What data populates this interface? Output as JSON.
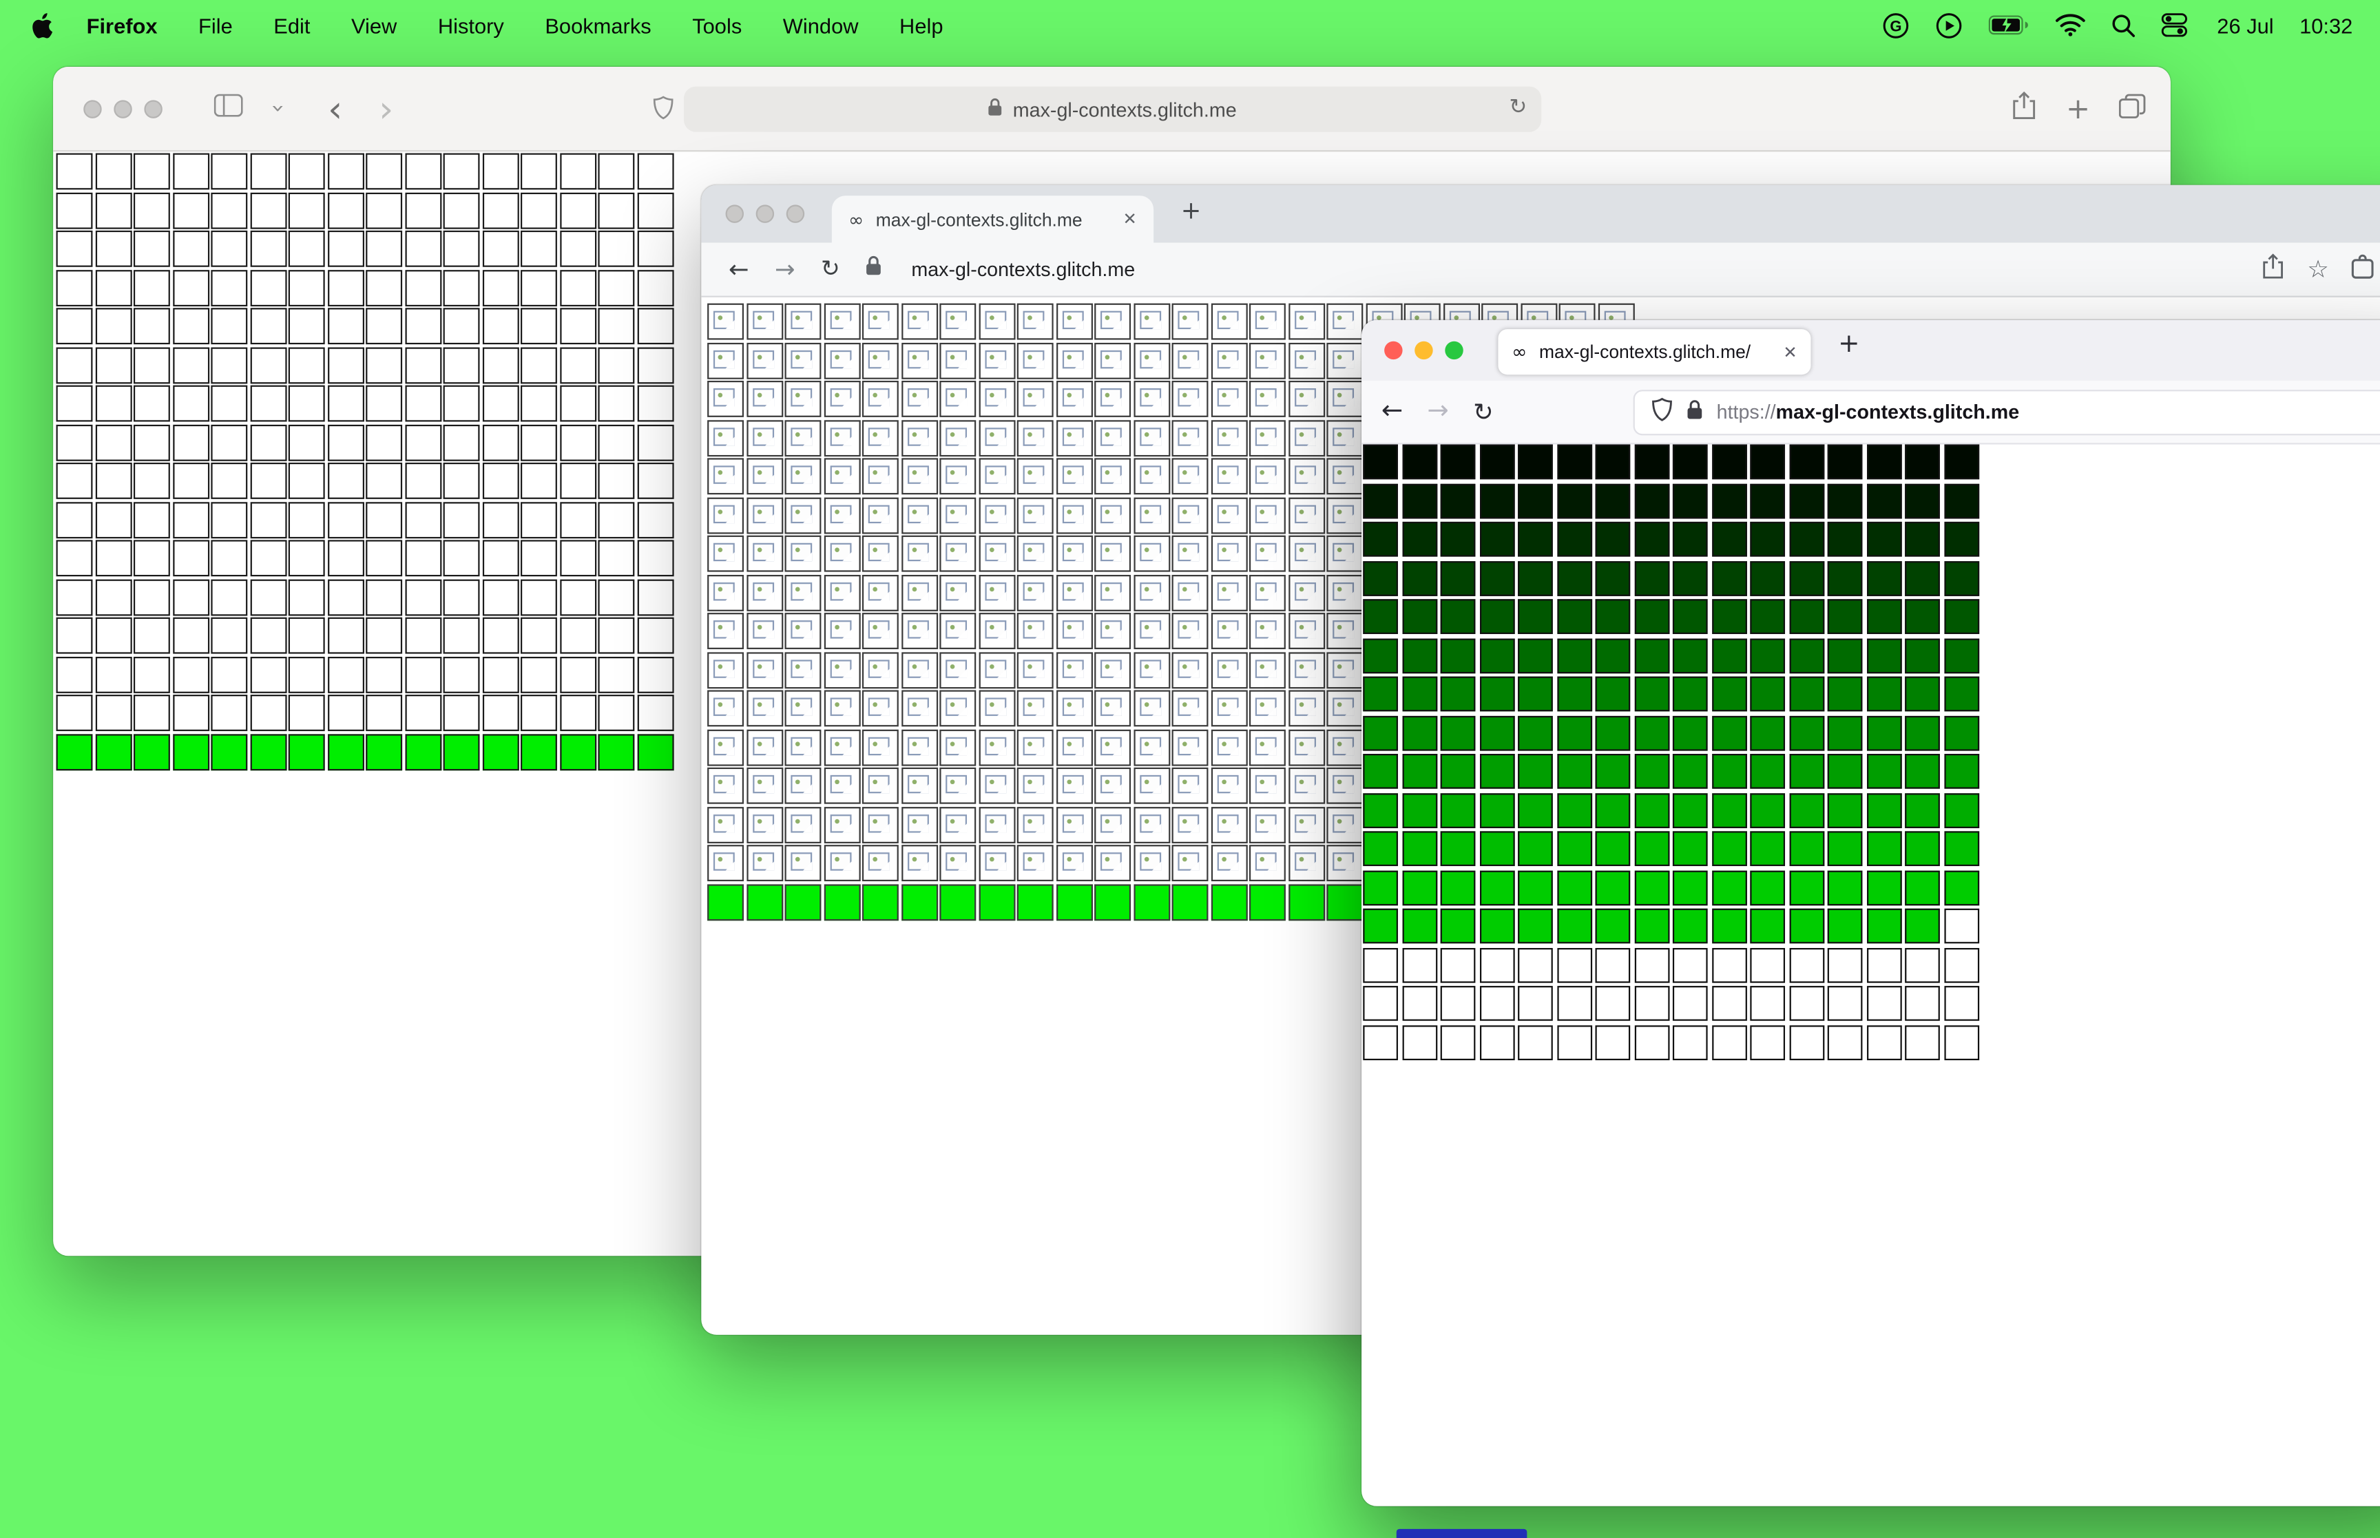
{
  "colors": {
    "desktop": "#69f669",
    "bright_green_row": "#00ee00",
    "traffic_red": "#ff5f57",
    "traffic_yellow": "#febc2e",
    "traffic_green": "#28c840"
  },
  "icons": {
    "infinity": "∞",
    "close": "✕",
    "plus": "+",
    "back_arrow": "←",
    "forward_arrow": "→",
    "reload": "↻",
    "back_chevron": "‹",
    "forward_chevron": "›",
    "chevron": "›",
    "star": "☆"
  },
  "menubar": {
    "app_name": "Firefox",
    "menus": [
      "File",
      "Edit",
      "View",
      "History",
      "Bookmarks",
      "Tools",
      "Window",
      "Help"
    ],
    "status": {
      "date": "26 Jul",
      "time": "10:32"
    }
  },
  "window1": {
    "url": "max-gl-contexts.glitch.me"
  },
  "window2": {
    "tab_title": "max-gl-contexts.glitch.me",
    "url": "max-gl-contexts.glitch.me"
  },
  "window3": {
    "tab_title": "max-gl-contexts.glitch.me/",
    "url_scheme": "https://",
    "url_host": "max-gl-contexts.glitch.me"
  },
  "grids": {
    "w1": {
      "cols": 16,
      "cell": 24,
      "gap": 1.5,
      "border": "#1a1a1a",
      "rows": [
        {
          "fill": "#ffffff",
          "repeat": 15
        },
        {
          "fill": "#00ee00"
        }
      ]
    },
    "w2": {
      "cols": 24,
      "cell": 24,
      "gap": 1.5,
      "border": "#3a3a3a",
      "rows": [
        {
          "fill": "#ffffff",
          "repeat": 15,
          "icon": "broken-image"
        },
        {
          "fill": "#00ee00"
        }
      ]
    },
    "w3": {
      "cols": 16,
      "cell": 23,
      "gap": 2.5,
      "border": "#111111",
      "rows": [
        {
          "fill": "#000a00"
        },
        {
          "fill": "#001a00"
        },
        {
          "fill": "#002e00"
        },
        {
          "fill": "#004200"
        },
        {
          "fill": "#005700"
        },
        {
          "fill": "#006b00"
        },
        {
          "fill": "#008000"
        },
        {
          "fill": "#008f00"
        },
        {
          "fill": "#009e00"
        },
        {
          "fill": "#00ad00"
        },
        {
          "fill": "#00bd00"
        },
        {
          "fill": "#00cc00"
        },
        {
          "fill": "#00cc00",
          "overrides": {
            "15": "#ffffff"
          }
        },
        {
          "fill": "#ffffff",
          "repeat": 3
        }
      ]
    }
  }
}
